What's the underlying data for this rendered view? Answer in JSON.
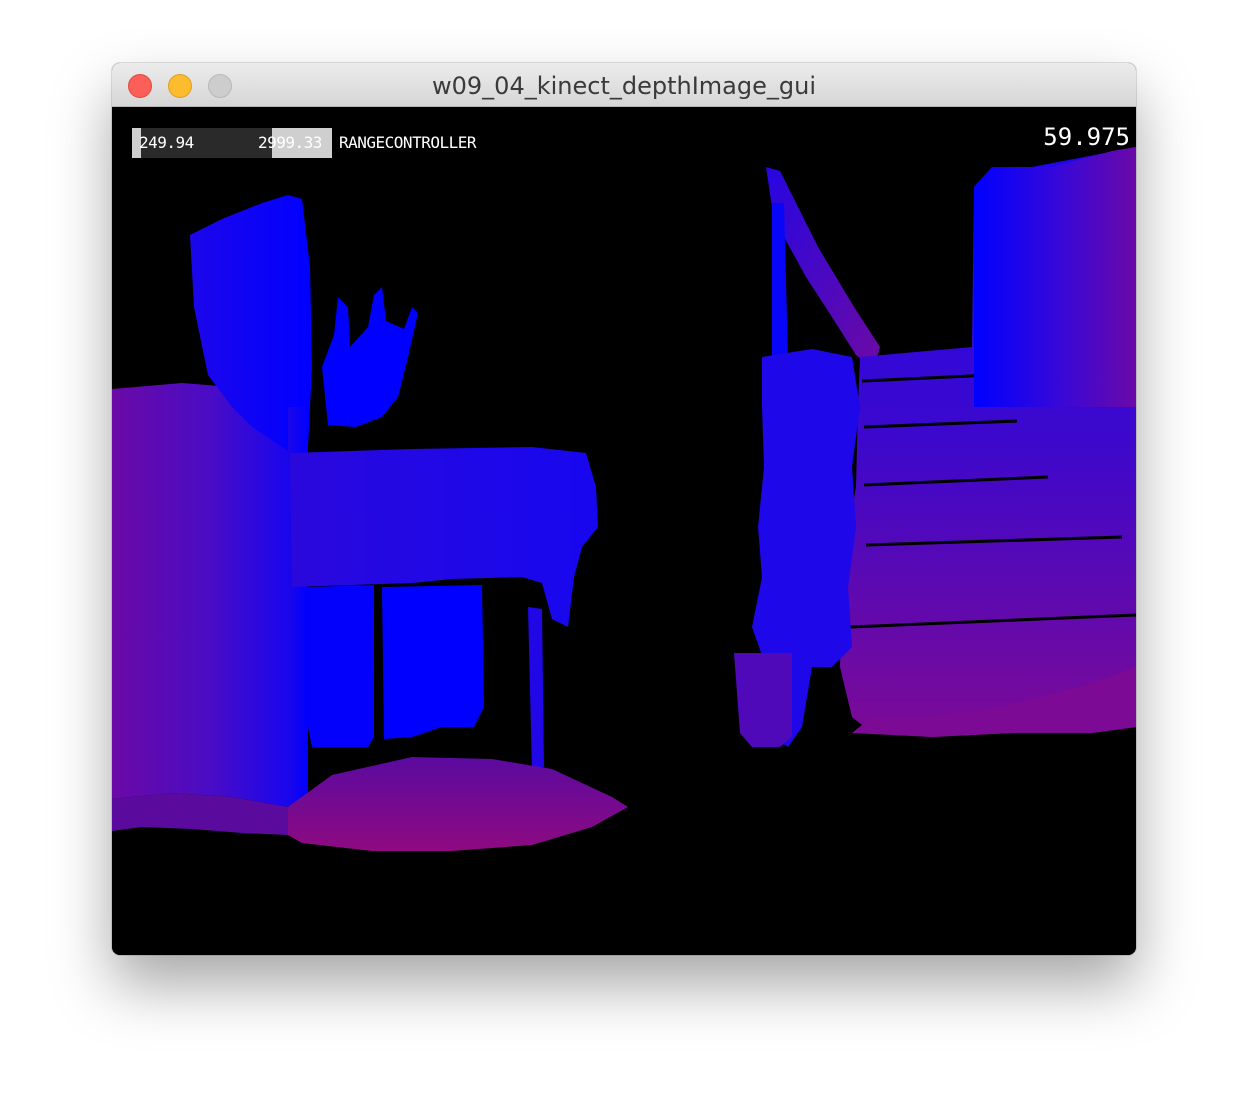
{
  "window": {
    "title": "w09_04_kinect_depthImage_gui"
  },
  "controls": {
    "range_controller": {
      "low_value": "249.94",
      "high_value": "2999.33",
      "label": "RANGECONTROLLER"
    },
    "fps": "59.975"
  },
  "colors": {
    "near": "#0000ff",
    "far": "#800080",
    "background": "#000000"
  },
  "icons": {
    "close": "close-traffic-light",
    "minimize": "minimize-traffic-light",
    "zoom": "zoom-traffic-light"
  }
}
